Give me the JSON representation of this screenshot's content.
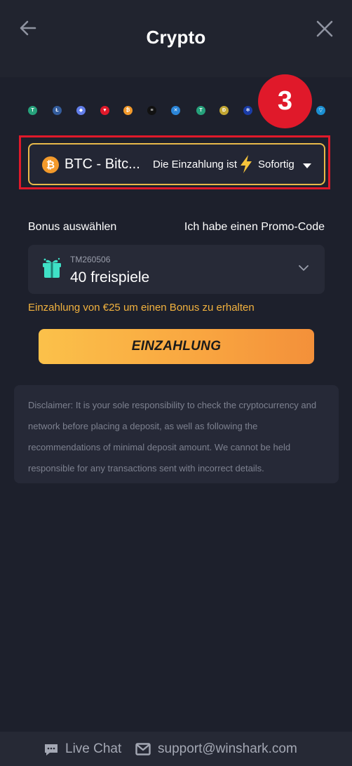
{
  "header": {
    "title": "Crypto"
  },
  "step_badge": "3",
  "currency_select": {
    "coin_symbol": "₿",
    "selected_label": "BTC - Bitc...",
    "deposit_prefix": "Die Einzahlung ist",
    "deposit_speed": "Sofortig"
  },
  "bonus": {
    "label": "Bonus auswählen",
    "promo_link": "Ich habe einen Promo-Code",
    "code": "TM260506",
    "name": "40 freispiele",
    "hint": "Einzahlung von €25 um einen Bonus zu erhalten"
  },
  "cta_label": "EINZAHLUNG",
  "disclaimer": "Disclaimer: It is your sole responsibility to check the cryptocurrency and network before placing a deposit, as well as following the recommendations of minimal deposit amount. We cannot be held responsible for any transactions sent with incorrect details.",
  "footer": {
    "chat_label": "Live Chat",
    "support_email": "support@winshark.com"
  },
  "coins": [
    {
      "icon": "tether-icon",
      "color": "#26a17b",
      "glyph": "T"
    },
    {
      "icon": "litecoin-icon",
      "color": "#345d9d",
      "glyph": "Ł"
    },
    {
      "icon": "ethereum-icon",
      "color": "#627eea",
      "glyph": "◆"
    },
    {
      "icon": "tron-icon",
      "color": "#e0192a",
      "glyph": "▼"
    },
    {
      "icon": "bitcoin-icon",
      "color": "#f39a2b",
      "glyph": "₿"
    },
    {
      "icon": "solana-icon",
      "color": "#111111",
      "glyph": "≡"
    },
    {
      "icon": "ripple-icon",
      "color": "#2b85d8",
      "glyph": "✕"
    },
    {
      "icon": "tether-trc-icon",
      "color": "#26a17b",
      "glyph": "T"
    },
    {
      "icon": "dogecoin-icon",
      "color": "#c2a633",
      "glyph": "Ð"
    },
    {
      "icon": "cardano-icon",
      "color": "#1a3ca8",
      "glyph": "✻"
    },
    {
      "icon": "ton-icon",
      "color": "#1b8fd2",
      "glyph": "▽"
    }
  ]
}
